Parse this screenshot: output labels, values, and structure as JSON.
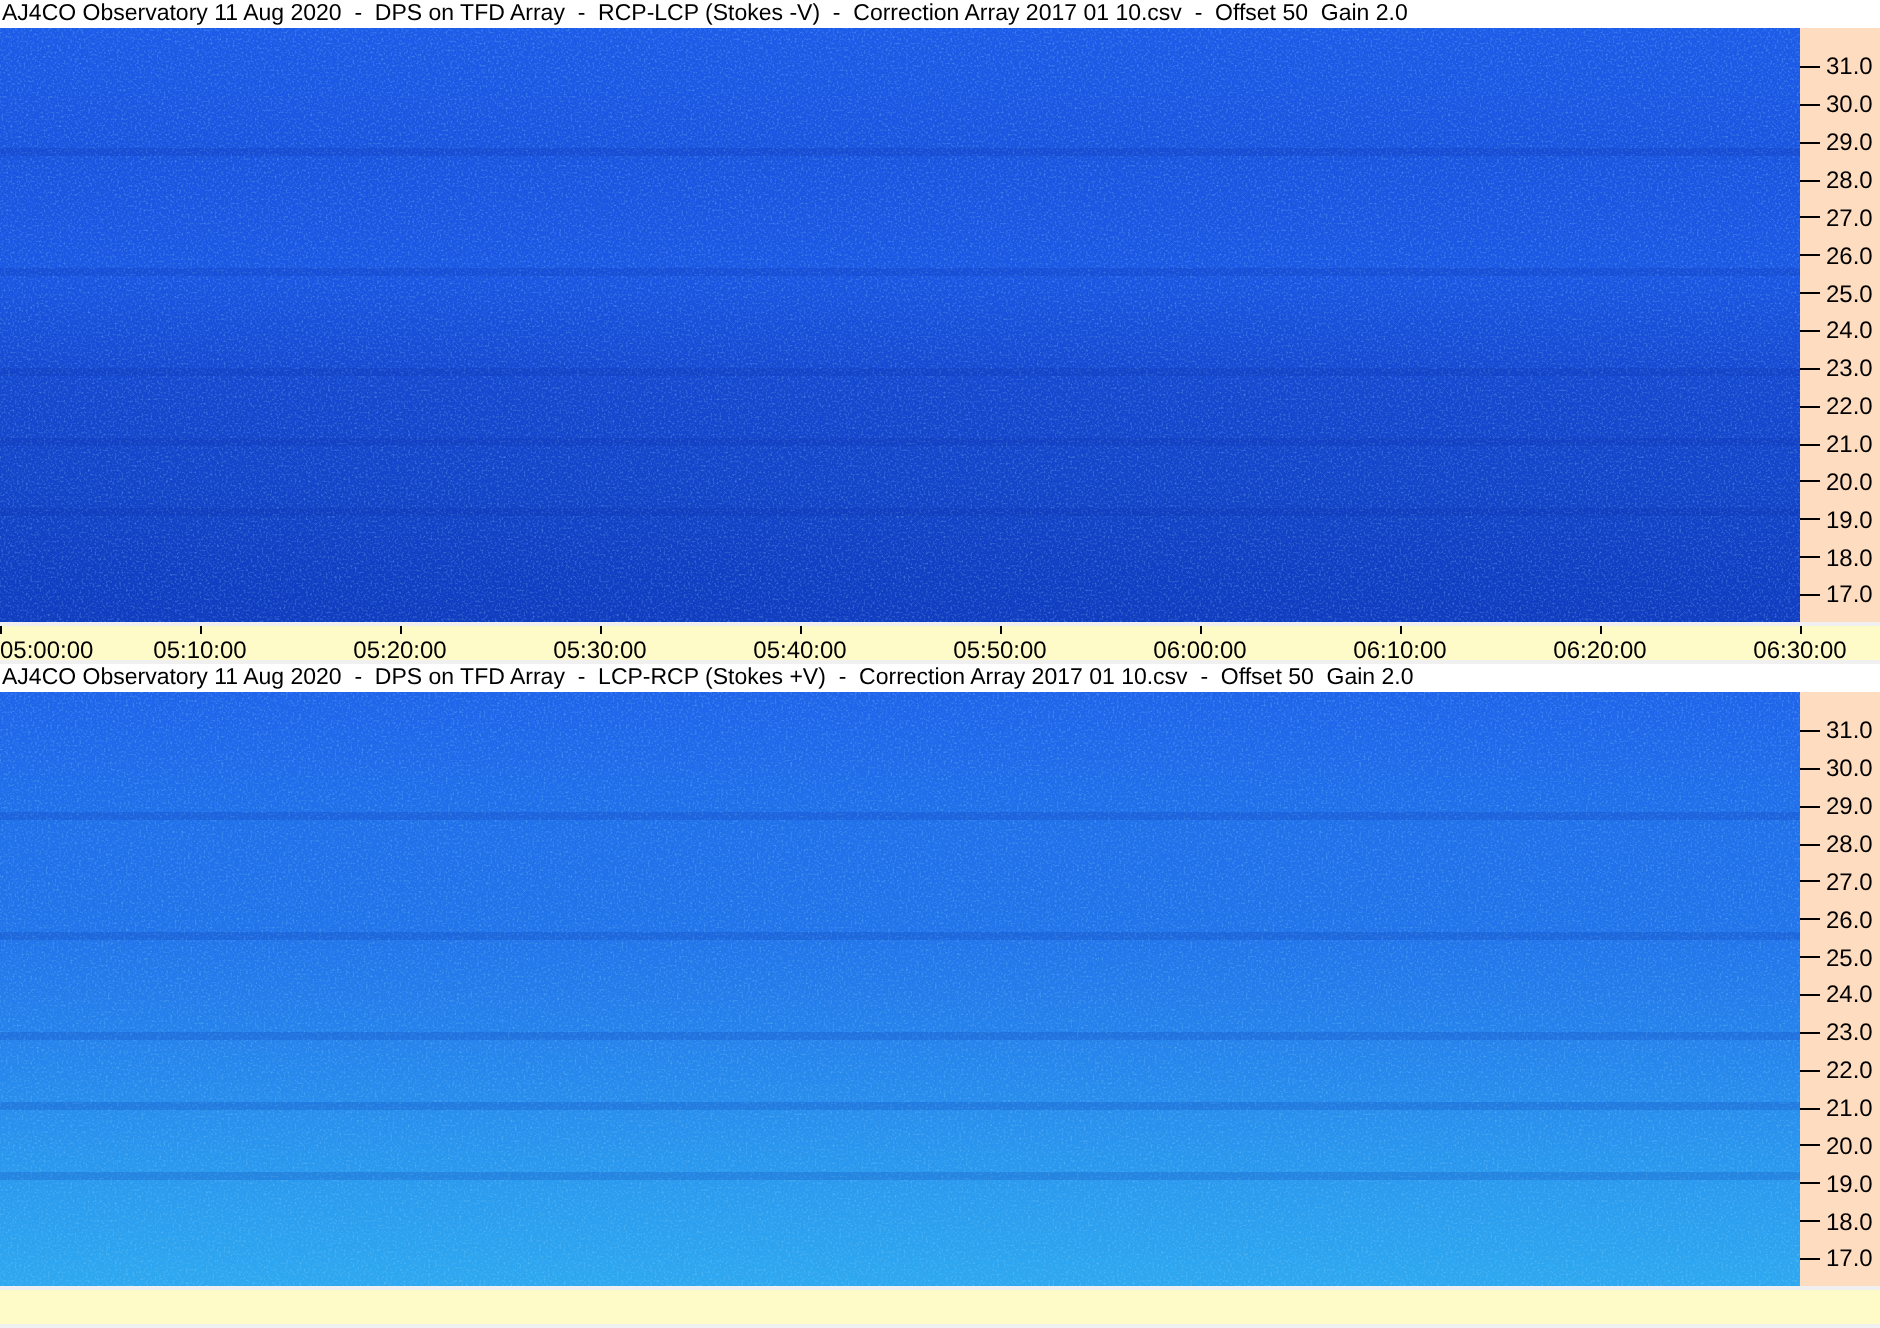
{
  "panels": [
    {
      "kind": "dark",
      "title": "AJ4CO Observatory 11 Aug 2020  -  DPS on TFD Array  -  RCP-LCP (Stokes -V)  -  Correction Array 2017 01 10.csv  -  Offset 50  Gain 2.0",
      "y_labels": [
        "31.0",
        "30.0",
        "29.0",
        "28.0",
        "27.0",
        "26.0",
        "25.0",
        "24.0",
        "23.0",
        "22.0",
        "21.0",
        "20.0",
        "19.0",
        "18.0",
        "17.0"
      ],
      "x_labels": [
        "05:00:00",
        "05:10:00",
        "05:20:00",
        "05:30:00",
        "05:40:00",
        "05:50:00",
        "06:00:00",
        "06:10:00",
        "06:20:00",
        "06:30:00"
      ]
    },
    {
      "kind": "light",
      "title": "AJ4CO Observatory 11 Aug 2020  -  DPS on TFD Array  -  LCP-RCP (Stokes +V)  -  Correction Array 2017 01 10.csv  -  Offset 50  Gain 2.0",
      "y_labels": [
        "31.0",
        "30.0",
        "29.0",
        "28.0",
        "27.0",
        "26.0",
        "25.0",
        "24.0",
        "23.0",
        "22.0",
        "21.0",
        "20.0",
        "19.0",
        "18.0",
        "17.0"
      ]
    }
  ]
}
